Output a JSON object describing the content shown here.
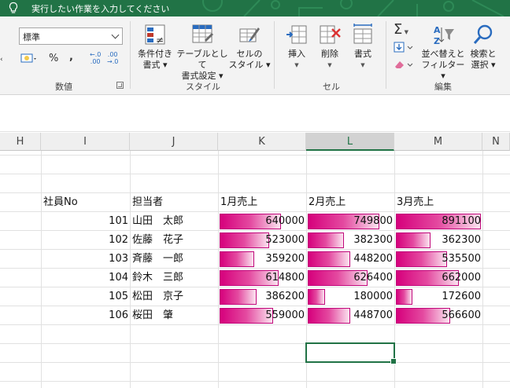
{
  "tell_me": "実行したい作業を入力してください",
  "ribbon": {
    "number_format_value": "標準",
    "percent_symbol": "%",
    "comma_symbol": ",",
    "inc_decimal": "←.0\n.00",
    "dec_decimal": ".00\n→.0",
    "groups": {
      "number": "数値",
      "style": "スタイル",
      "cells": "セル",
      "editing": "編集"
    },
    "buttons": {
      "conditional_formatting": [
        "条件付き",
        "書式 ▾"
      ],
      "format_as_table": [
        "テーブルとして",
        "書式設定 ▾"
      ],
      "cell_styles": [
        "セルの",
        "スタイル ▾"
      ],
      "insert": "挿入",
      "delete": "削除",
      "format": "書式",
      "sort_filter": [
        "並べ替えと",
        "フィルター ▾"
      ],
      "find_select": [
        "検索と",
        "選択 ▾"
      ]
    }
  },
  "columns": [
    "H",
    "I",
    "J",
    "K",
    "L",
    "M",
    "N"
  ],
  "selected_column": "L",
  "table": {
    "headers": [
      "社員No",
      "担当者",
      "1月売上",
      "2月売上",
      "3月売上"
    ],
    "max_value": 891100,
    "rows": [
      {
        "no": "101",
        "name": "山田　太郎",
        "jan": 640000,
        "feb": 749800,
        "mar": 891100
      },
      {
        "no": "102",
        "name": "佐藤　花子",
        "jan": 523000,
        "feb": 382300,
        "mar": 362300
      },
      {
        "no": "103",
        "name": "斉藤　一郎",
        "jan": 359200,
        "feb": 448200,
        "mar": 535500
      },
      {
        "no": "104",
        "name": "鈴木　三郎",
        "jan": 614800,
        "feb": 626400,
        "mar": 662000
      },
      {
        "no": "105",
        "name": "松田　京子",
        "jan": 386200,
        "feb": 180000,
        "mar": 172600
      },
      {
        "no": "106",
        "name": "桜田　肇",
        "jan": 559000,
        "feb": 448700,
        "mar": 566600
      }
    ]
  },
  "colors": {
    "title_bar": "#217346",
    "databar": "#d6007c",
    "selection": "#217346"
  }
}
